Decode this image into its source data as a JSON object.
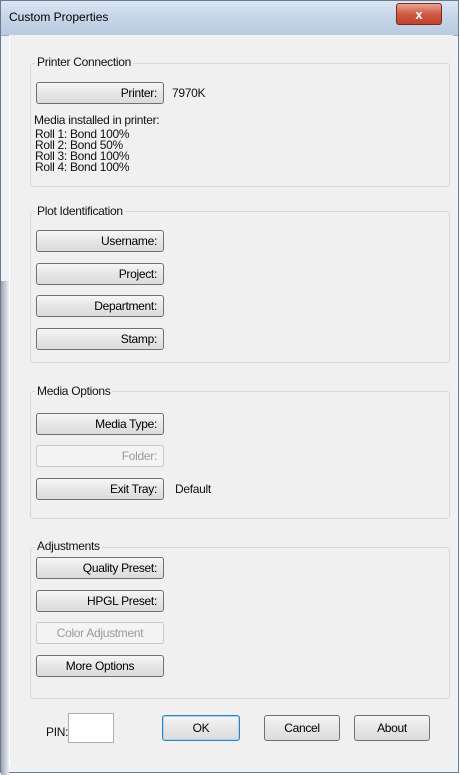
{
  "window": {
    "title": "Custom Properties",
    "close_glyph": "x"
  },
  "printer_connection": {
    "title": "Printer Connection",
    "printer_button": "Printer:",
    "printer_value": "7970K",
    "media_label": "Media installed in  printer:",
    "rolls": [
      "Roll 1: Bond  100%",
      "Roll 2: Bond  50%",
      "Roll 3: Bond  100%",
      "Roll 4: Bond  100%"
    ]
  },
  "plot_identification": {
    "title": "Plot Identification",
    "username_button": "Username:",
    "project_button": "Project:",
    "department_button": "Department:",
    "stamp_button": "Stamp:"
  },
  "media_options": {
    "title": "Media Options",
    "media_type_button": "Media Type:",
    "folder_button": "Folder:",
    "exit_tray_button": "Exit Tray:",
    "exit_tray_value": "Default"
  },
  "adjustments": {
    "title": "Adjustments",
    "quality_preset_button": "Quality Preset:",
    "hpgl_preset_button": "HPGL Preset:",
    "color_adjustment_button": "Color Adjustment",
    "more_options_button": "More Options"
  },
  "footer": {
    "pin_label": "PIN:",
    "pin_value": "",
    "ok_button": "OK",
    "cancel_button": "Cancel",
    "about_button": "About"
  }
}
